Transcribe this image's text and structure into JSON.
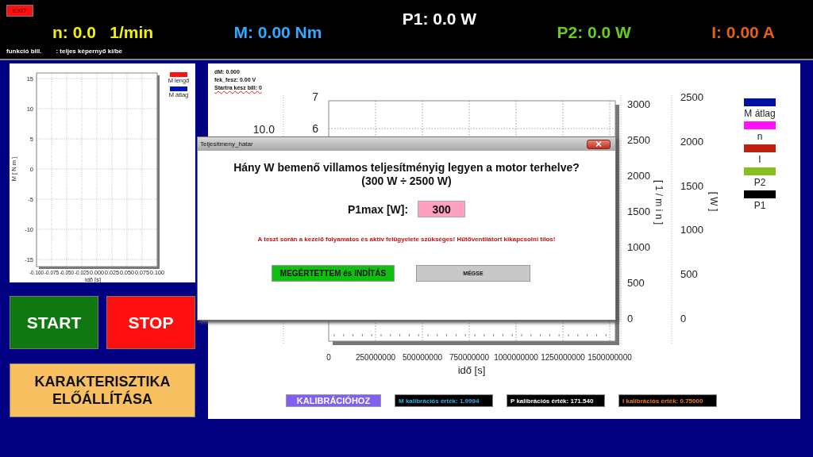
{
  "top_bar": {
    "exit_button": "EXIT",
    "readouts": [
      {
        "text": "n: 0.0   1/min",
        "color": "#f2f200",
        "kind": "normal"
      },
      {
        "text": "M: 0.00 Nm",
        "color": "#33aaff",
        "kind": "normal"
      },
      {
        "text": "P1: 0.0 W",
        "color": "#ffffff",
        "kind": "raised"
      },
      {
        "text": "P2: 0.0 W",
        "color": "#66cc22",
        "kind": "normal"
      },
      {
        "text": "I: 0.00 A",
        "color": "#e0601c",
        "kind": "normal"
      }
    ],
    "hint_key": "funkció bill.",
    "hint_text": ": teljes képernyő ki/be"
  },
  "left_panel": {
    "plot": {
      "x_axis": {
        "label": "idő [s]",
        "ticks": [
          "-0.100",
          "-0.075",
          "-0.050",
          "-0.025",
          "0.000",
          "0.025",
          "0.050",
          "0.075",
          "0.100"
        ]
      },
      "y_axis": {
        "label": "M [ N m ]",
        "ticks": [
          "15",
          "10",
          "5",
          "0",
          "-5",
          "-10",
          "-15"
        ]
      },
      "legend": [
        {
          "name": "M lengő",
          "color": "#ff1010"
        },
        {
          "name": "M átlag",
          "color": "#0010c0"
        }
      ]
    },
    "buttons": [
      {
        "label": "START",
        "color": "#107810"
      },
      {
        "label": "STOP",
        "color": "#ff1010"
      }
    ],
    "wide_button": {
      "label": "KARAKTERISZTIKA ELŐÁLLÍTÁSA",
      "color": "#f8c060"
    }
  },
  "right_panel": {
    "status_lines": [
      {
        "text": "dM: 0.000",
        "kind": "plain"
      },
      {
        "text": "fek_fesz: 0.00 V",
        "kind": "plain"
      },
      {
        "text": "Startra kész bill: 0",
        "kind": "flagged"
      }
    ],
    "plot": {
      "x_axis": {
        "label": "idő [s]",
        "ticks": [
          "0",
          "250000000",
          "500000000",
          "750000000",
          "1000000000",
          "1250000000",
          "1500000000"
        ]
      },
      "y_axes": [
        {
          "kind": "left_outer",
          "ticks": [
            "10.0"
          ]
        },
        {
          "kind": "left_inner",
          "ticks": [
            "7",
            "6"
          ]
        },
        {
          "kind": "right_inner",
          "label": "[ 1 / m i n ]",
          "ticks": [
            "3000",
            "2500",
            "2000",
            "1500",
            "1000",
            "500",
            "0"
          ]
        },
        {
          "kind": "right_outer",
          "label": "[ W ]",
          "ticks": [
            "2500",
            "2000",
            "1500",
            "1000",
            "500",
            "0"
          ]
        }
      ],
      "legend": [
        {
          "name": "M átlag",
          "color": "#0010a0"
        },
        {
          "name": "n",
          "color": "#ff10ff"
        },
        {
          "name": "I",
          "color": "#c02010"
        },
        {
          "name": "P2",
          "color": "#88c020"
        },
        {
          "name": "P1",
          "color": "#000000"
        }
      ]
    },
    "calibration": {
      "button": "KALIBRÁCIÓHOZ",
      "values": [
        {
          "text": "M kalibrációs érték: 1.9994",
          "color": "#30b0e0"
        },
        {
          "text": "P kalibrációs érték: 171.540",
          "color": "#ffffff"
        },
        {
          "text": "I kalibrációs érték: 0.75000",
          "color": "#f07820"
        }
      ]
    }
  },
  "dialog": {
    "title": "Teljesitmeny_hatar",
    "question": "Hány W bemenő villamos teljesítményig legyen a motor terhelve?",
    "range": "(300 W ÷ 2500 W)",
    "field_label": "P1max [W]:",
    "field_value": "300",
    "warning": "A teszt során a kezelő folyamatos és aktiv felügyelete szükséges! Hűtőventilátort kikapcsolni tilos!",
    "buttons": [
      {
        "label": "MEGÉRTETTEM és INDÍTÁS",
        "kind": "confirm"
      },
      {
        "label": "MÉGSE",
        "kind": "cancel"
      }
    ]
  }
}
